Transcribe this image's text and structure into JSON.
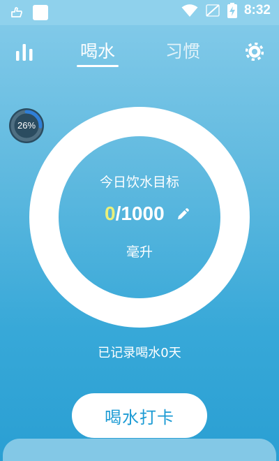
{
  "status_bar": {
    "time": "8:32"
  },
  "tabs": [
    {
      "label": "喝水",
      "active": true
    },
    {
      "label": "习惯",
      "active": false
    }
  ],
  "progress": {
    "percent_label": "26%",
    "percent_value": 0.26
  },
  "goal": {
    "label": "今日饮水目标",
    "current": "0",
    "separator": "/",
    "target": "1000",
    "unit": "毫升"
  },
  "record": {
    "text": "已记录喝水0天"
  },
  "checkin_button": {
    "label": "喝水打卡"
  },
  "icons": {
    "stats": "bar-chart-icon",
    "settings": "gear-icon",
    "edit": "pencil-icon"
  },
  "colors": {
    "accent": "#1c9bd4",
    "current_value": "#e9f07a",
    "badge_arc": "#2f7fd8",
    "badge_bg": "#2b4c60"
  }
}
